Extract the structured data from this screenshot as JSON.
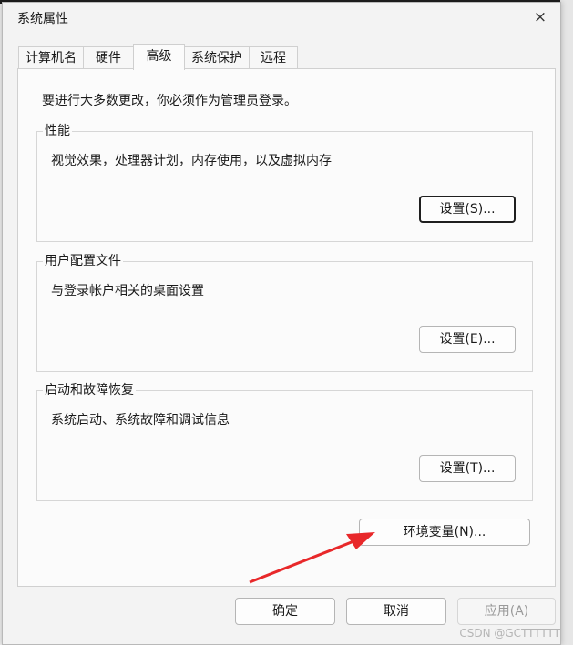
{
  "window": {
    "title": "系统属性",
    "close_icon": "×"
  },
  "tabs": [
    {
      "label": "计算机名"
    },
    {
      "label": "硬件"
    },
    {
      "label": "高级"
    },
    {
      "label": "系统保护"
    },
    {
      "label": "远程"
    }
  ],
  "active_tab": "高级",
  "intro": "要进行大多数更改，你必须作为管理员登录。",
  "groups": {
    "performance": {
      "title": "性能",
      "desc": "视觉效果，处理器计划，内存使用，以及虚拟内存",
      "button": "设置(S)..."
    },
    "profile": {
      "title": "用户配置文件",
      "desc": "与登录帐户相关的桌面设置",
      "button": "设置(E)..."
    },
    "startup": {
      "title": "启动和故障恢复",
      "desc": "系统启动、系统故障和调试信息",
      "button": "设置(T)..."
    }
  },
  "env_button": "环境变量(N)...",
  "footer": {
    "ok": "确定",
    "cancel": "取消",
    "apply": "应用(A)"
  },
  "watermark": "CSDN @GCTTTTTT",
  "annotation_color": "#e8282a"
}
